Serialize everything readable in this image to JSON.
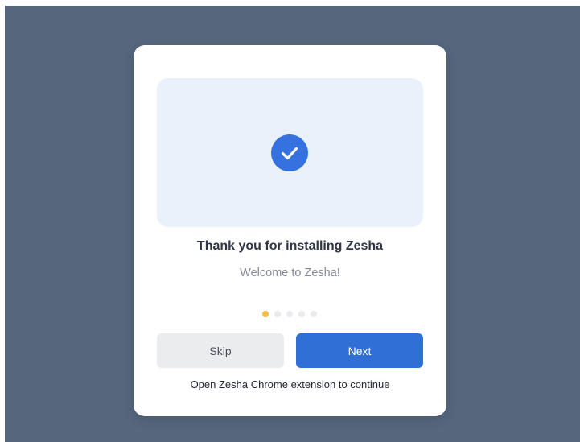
{
  "dialog": {
    "title": "Thank you for installing Zesha",
    "subtitle": "Welcome to Zesha!",
    "hero_icon": "check-circle-icon",
    "steps": {
      "total": 5,
      "current": 1
    },
    "skip_label": "Skip",
    "next_label": "Next",
    "footnote": "Open Zesha Chrome extension to continue"
  },
  "colors": {
    "backdrop": "#55667d",
    "accent": "#2f6fd6",
    "check": "#3572e0",
    "hero_bg": "#eaf1fb",
    "active_dot": "#f3c043"
  }
}
